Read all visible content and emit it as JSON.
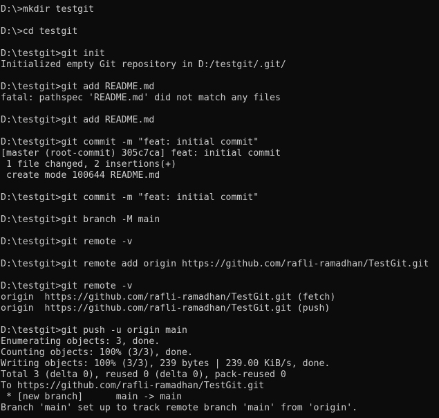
{
  "terminal": {
    "lines": [
      "D:\\>mkdir testgit",
      "",
      "D:\\>cd testgit",
      "",
      "D:\\testgit>git init",
      "Initialized empty Git repository in D:/testgit/.git/",
      "",
      "D:\\testgit>git add README.md",
      "fatal: pathspec 'README.md' did not match any files",
      "",
      "D:\\testgit>git add README.md",
      "",
      "D:\\testgit>git commit -m \"feat: initial commit\"",
      "[master (root-commit) 305c7ca] feat: initial commit",
      " 1 file changed, 2 insertions(+)",
      " create mode 100644 README.md",
      "",
      "D:\\testgit>git commit -m \"feat: initial commit\"",
      "",
      "D:\\testgit>git branch -M main",
      "",
      "D:\\testgit>git remote -v",
      "",
      "D:\\testgit>git remote add origin https://github.com/rafli-ramadhan/TestGit.git",
      "",
      "D:\\testgit>git remote -v",
      "origin  https://github.com/rafli-ramadhan/TestGit.git (fetch)",
      "origin  https://github.com/rafli-ramadhan/TestGit.git (push)",
      "",
      "D:\\testgit>git push -u origin main",
      "Enumerating objects: 3, done.",
      "Counting objects: 100% (3/3), done.",
      "Writing objects: 100% (3/3), 239 bytes | 239.00 KiB/s, done.",
      "Total 3 (delta 0), reused 0 (delta 0), pack-reused 0",
      "To https://github.com/rafli-ramadhan/TestGit.git",
      " * [new branch]      main -> main",
      "Branch 'main' set up to track remote branch 'main' from 'origin'."
    ]
  },
  "colors": {
    "background": "#0c0c0c",
    "text": "#cccccc"
  }
}
